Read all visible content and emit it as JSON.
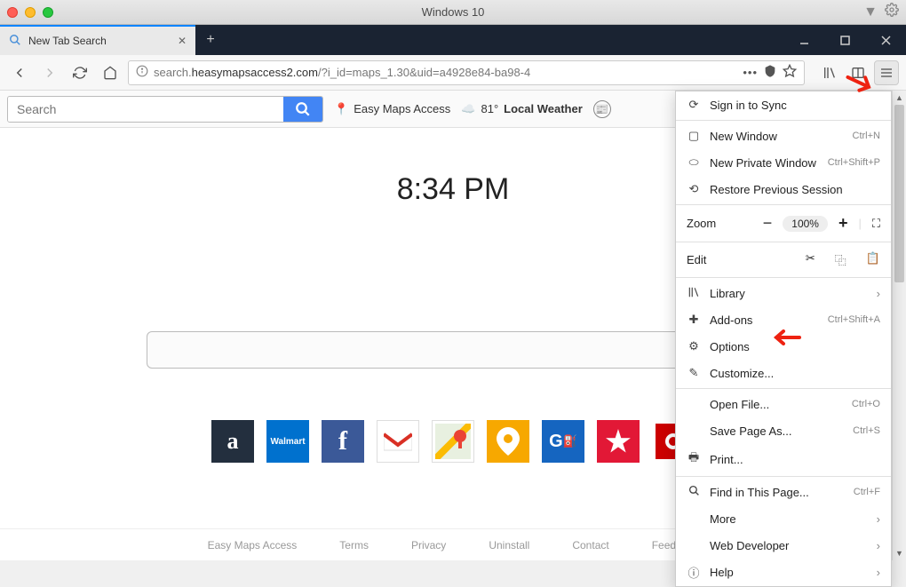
{
  "window": {
    "title": "Windows 10"
  },
  "tab": {
    "title": "New Tab Search"
  },
  "url": {
    "domain": "search.heasymapsaccess2.com",
    "path": "/?i_id=maps_1.30&uid=a4928e84-ba98-4"
  },
  "toolbar": {
    "search_placeholder": "Search",
    "maps_label": "Easy Maps Access",
    "weather_temp": "81°",
    "weather_label": "Local Weather"
  },
  "clock": "8:34 PM",
  "shortcuts": {
    "amazon": "a",
    "walmart": "Walmart",
    "facebook": "f",
    "gas": "G"
  },
  "footer": {
    "items": [
      "Easy Maps Access",
      "Terms",
      "Privacy",
      "Uninstall",
      "Contact",
      "Feedback"
    ]
  },
  "menu": {
    "sync": "Sign in to Sync",
    "new_window": {
      "label": "New Window",
      "shortcut": "Ctrl+N"
    },
    "private": {
      "label": "New Private Window",
      "shortcut": "Ctrl+Shift+P"
    },
    "restore": "Restore Previous Session",
    "zoom_label": "Zoom",
    "zoom_value": "100%",
    "edit_label": "Edit",
    "library": "Library",
    "addons": {
      "label": "Add-ons",
      "shortcut": "Ctrl+Shift+A"
    },
    "options": "Options",
    "customize": "Customize...",
    "open_file": {
      "label": "Open File...",
      "shortcut": "Ctrl+O"
    },
    "save_as": {
      "label": "Save Page As...",
      "shortcut": "Ctrl+S"
    },
    "print": "Print...",
    "find": {
      "label": "Find in This Page...",
      "shortcut": "Ctrl+F"
    },
    "more": "More",
    "webdev": "Web Developer",
    "help": "Help"
  }
}
